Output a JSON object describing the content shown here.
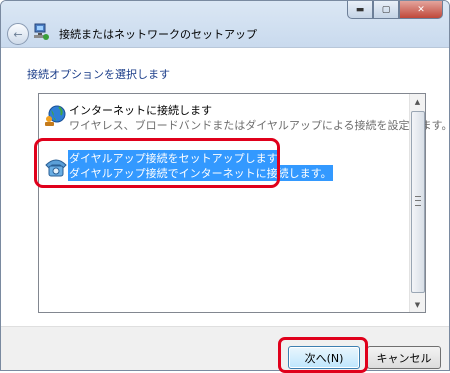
{
  "window": {
    "title": "接続またはネットワークのセットアップ",
    "caption_buttons": {
      "minimize": "▬",
      "maximize": "▢",
      "close": "✕"
    }
  },
  "nav": {
    "back_icon": "back-arrow-icon",
    "back_glyph": "←"
  },
  "page": {
    "instruction": "接続オプションを選択します"
  },
  "options": [
    {
      "title": "インターネットに接続します",
      "description": "ワイヤレス、ブロードバンドまたはダイヤルアップによる接続を設定します。",
      "icon": "globe-network-icon",
      "selected": false
    },
    {
      "title": "ダイヤルアップ接続をセットアップします",
      "description": "ダイヤルアップ接続でインターネットに接続します。",
      "icon": "telephone-icon",
      "selected": true
    }
  ],
  "scrollbar": {
    "up": "▲",
    "down": "▼"
  },
  "footer": {
    "next_label": "次へ(N)",
    "cancel_label": "キャンセル"
  },
  "colors": {
    "highlight_border": "#e0001b",
    "selection": "#3399ff",
    "instruction_text": "#1c3e8a"
  }
}
